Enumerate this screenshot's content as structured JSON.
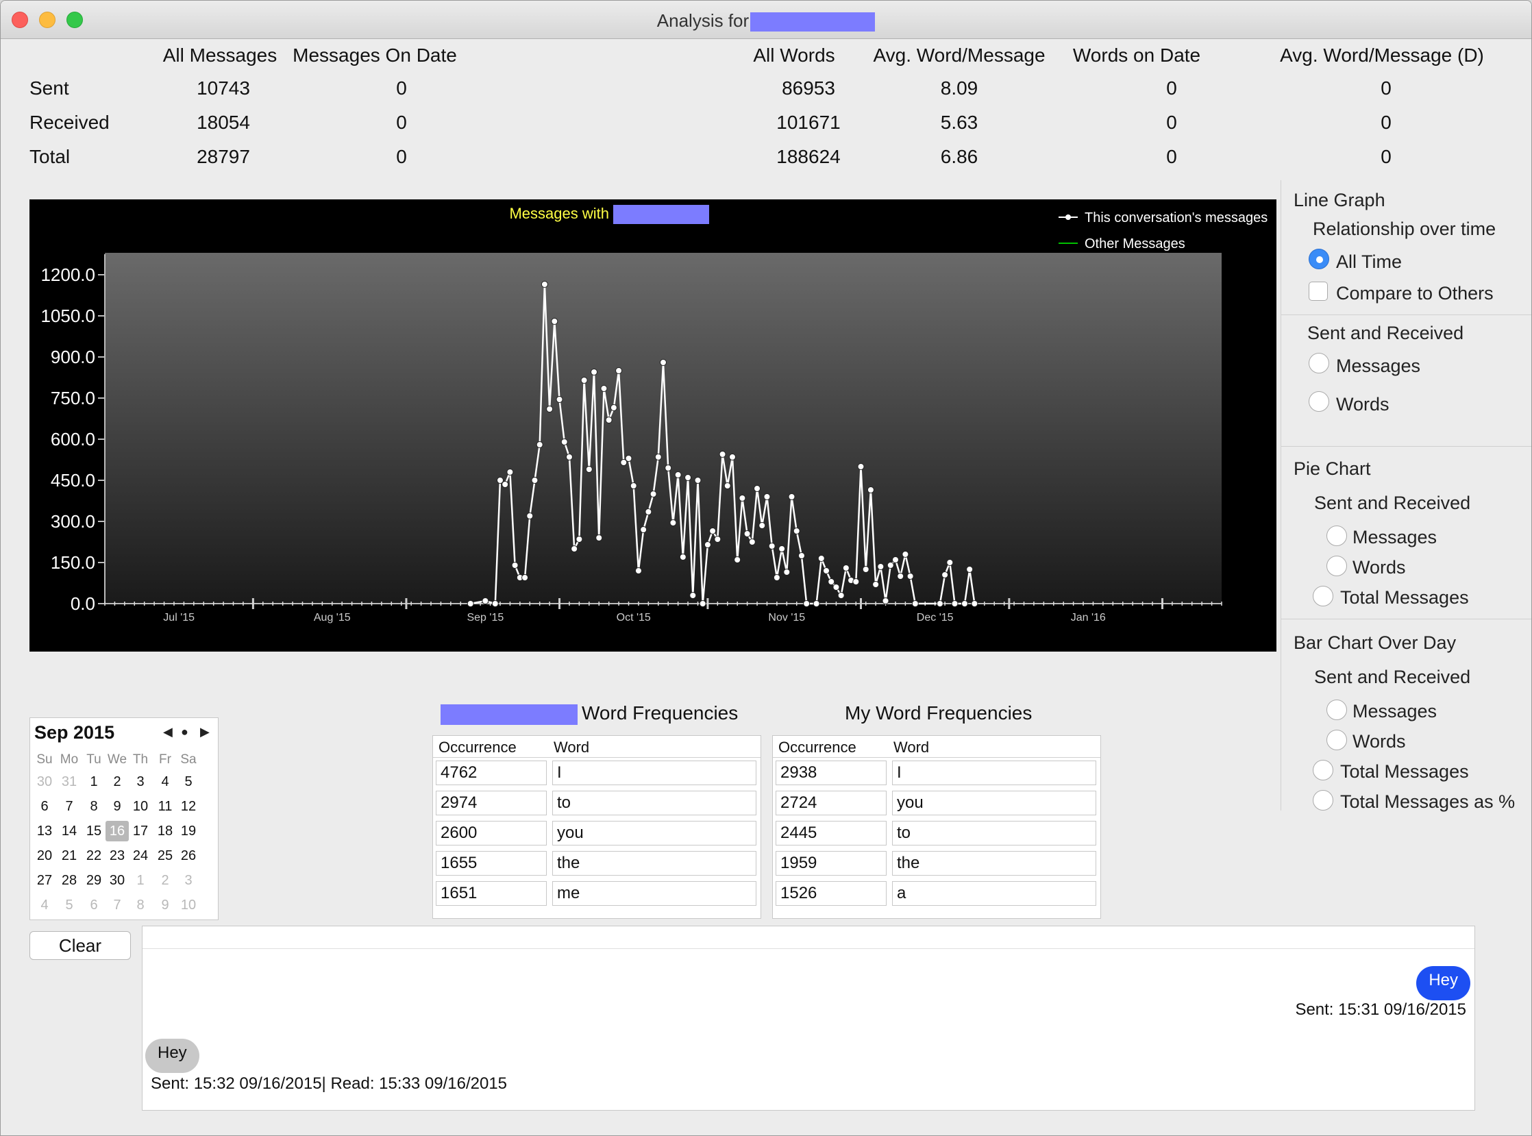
{
  "window": {
    "title": "Analysis for"
  },
  "stats": {
    "headers": [
      "All Messages",
      "Messages On Date",
      "All Words",
      "Avg. Word/Message",
      "Words on Date",
      "Avg. Word/Message (D)"
    ],
    "rows": [
      {
        "label": "Sent",
        "values": [
          "10743",
          "0",
          "86953",
          "8.09",
          "0",
          "0"
        ]
      },
      {
        "label": "Received",
        "values": [
          "18054",
          "0",
          "101671",
          "5.63",
          "0",
          "0"
        ]
      },
      {
        "label": "Total",
        "values": [
          "28797",
          "0",
          "188624",
          "6.86",
          "0",
          "0"
        ]
      }
    ]
  },
  "chart_data": {
    "type": "line",
    "title": "Messages with",
    "xlabel": "",
    "ylabel": "",
    "ylim": [
      0,
      1200
    ],
    "y_ticks": [
      "0.0",
      "150.0",
      "300.0",
      "450.0",
      "600.0",
      "750.0",
      "900.0",
      "1050.0",
      "1200.0"
    ],
    "x_ticks": [
      "Jul '15",
      "Aug '15",
      "Sep '15",
      "Oct '15",
      "Nov '15",
      "Dec '15",
      "Jan '16"
    ],
    "x_range": [
      "2015-06-16",
      "2016-01-28"
    ],
    "legend_position": "top-right",
    "grid": false,
    "series": [
      {
        "name": "This conversation's messages",
        "color": "#ffffff",
        "points": [
          [
            "2015-08-29",
            0
          ],
          [
            "2015-09-01",
            10
          ],
          [
            "2015-09-03",
            0
          ],
          [
            "2015-09-04",
            450
          ],
          [
            "2015-09-05",
            435
          ],
          [
            "2015-09-06",
            480
          ],
          [
            "2015-09-07",
            140
          ],
          [
            "2015-09-08",
            95
          ],
          [
            "2015-09-09",
            95
          ],
          [
            "2015-09-10",
            320
          ],
          [
            "2015-09-11",
            450
          ],
          [
            "2015-09-12",
            580
          ],
          [
            "2015-09-13",
            1165
          ],
          [
            "2015-09-14",
            710
          ],
          [
            "2015-09-15",
            1030
          ],
          [
            "2015-09-16",
            745
          ],
          [
            "2015-09-17",
            590
          ],
          [
            "2015-09-18",
            535
          ],
          [
            "2015-09-19",
            200
          ],
          [
            "2015-09-20",
            235
          ],
          [
            "2015-09-21",
            815
          ],
          [
            "2015-09-22",
            490
          ],
          [
            "2015-09-23",
            845
          ],
          [
            "2015-09-24",
            240
          ],
          [
            "2015-09-25",
            785
          ],
          [
            "2015-09-26",
            670
          ],
          [
            "2015-09-27",
            715
          ],
          [
            "2015-09-28",
            850
          ],
          [
            "2015-09-29",
            515
          ],
          [
            "2015-09-30",
            530
          ],
          [
            "2015-10-01",
            430
          ],
          [
            "2015-10-02",
            120
          ],
          [
            "2015-10-03",
            270
          ],
          [
            "2015-10-04",
            335
          ],
          [
            "2015-10-05",
            400
          ],
          [
            "2015-10-06",
            535
          ],
          [
            "2015-10-07",
            880
          ],
          [
            "2015-10-08",
            495
          ],
          [
            "2015-10-09",
            295
          ],
          [
            "2015-10-10",
            470
          ],
          [
            "2015-10-11",
            170
          ],
          [
            "2015-10-12",
            460
          ],
          [
            "2015-10-13",
            30
          ],
          [
            "2015-10-14",
            450
          ],
          [
            "2015-10-15",
            0
          ],
          [
            "2015-10-16",
            215
          ],
          [
            "2015-10-17",
            265
          ],
          [
            "2015-10-18",
            235
          ],
          [
            "2015-10-19",
            545
          ],
          [
            "2015-10-20",
            430
          ],
          [
            "2015-10-21",
            535
          ],
          [
            "2015-10-22",
            160
          ],
          [
            "2015-10-23",
            385
          ],
          [
            "2015-10-24",
            255
          ],
          [
            "2015-10-25",
            225
          ],
          [
            "2015-10-26",
            420
          ],
          [
            "2015-10-27",
            285
          ],
          [
            "2015-10-28",
            390
          ],
          [
            "2015-10-29",
            210
          ],
          [
            "2015-10-30",
            95
          ],
          [
            "2015-10-31",
            200
          ],
          [
            "2015-11-01",
            115
          ],
          [
            "2015-11-02",
            390
          ],
          [
            "2015-11-03",
            265
          ],
          [
            "2015-11-04",
            175
          ],
          [
            "2015-11-05",
            0
          ],
          [
            "2015-11-07",
            0
          ],
          [
            "2015-11-08",
            165
          ],
          [
            "2015-11-09",
            120
          ],
          [
            "2015-11-10",
            80
          ],
          [
            "2015-11-11",
            60
          ],
          [
            "2015-11-12",
            30
          ],
          [
            "2015-11-13",
            130
          ],
          [
            "2015-11-14",
            85
          ],
          [
            "2015-11-15",
            80
          ],
          [
            "2015-11-16",
            500
          ],
          [
            "2015-11-17",
            125
          ],
          [
            "2015-11-18",
            415
          ],
          [
            "2015-11-19",
            70
          ],
          [
            "2015-11-20",
            135
          ],
          [
            "2015-11-21",
            10
          ],
          [
            "2015-11-22",
            140
          ],
          [
            "2015-11-23",
            160
          ],
          [
            "2015-11-24",
            100
          ],
          [
            "2015-11-25",
            180
          ],
          [
            "2015-11-26",
            100
          ],
          [
            "2015-11-27",
            0
          ],
          [
            "2015-12-02",
            0
          ],
          [
            "2015-12-03",
            105
          ],
          [
            "2015-12-04",
            150
          ],
          [
            "2015-12-05",
            0
          ],
          [
            "2015-12-07",
            0
          ],
          [
            "2015-12-08",
            125
          ],
          [
            "2015-12-09",
            0
          ]
        ]
      },
      {
        "name": "Other Messages",
        "color": "#00c000",
        "points": []
      }
    ]
  },
  "right_panel": {
    "line_graph": {
      "heading": "Line Graph",
      "sub": "Relationship over time",
      "all_time": "All Time",
      "compare": "Compare to Others"
    },
    "sent_received": {
      "heading": "Sent and Received",
      "messages": "Messages",
      "words": "Words"
    },
    "pie_chart": {
      "heading": "Pie Chart",
      "sub": "Sent and Received",
      "messages": "Messages",
      "words": "Words",
      "total": "Total Messages"
    },
    "bar_chart": {
      "heading": "Bar Chart Over Day",
      "sub": "Sent and Received",
      "messages": "Messages",
      "words": "Words",
      "total": "Total Messages",
      "total_pct": "Total Messages as %"
    }
  },
  "calendar": {
    "month": "Sep 2015",
    "dow": [
      "Su",
      "Mo",
      "Tu",
      "We",
      "Th",
      "Fr",
      "Sa"
    ],
    "weeks": [
      [
        "30",
        "31",
        "1",
        "2",
        "3",
        "4",
        "5"
      ],
      [
        "6",
        "7",
        "8",
        "9",
        "10",
        "11",
        "12"
      ],
      [
        "13",
        "14",
        "15",
        "16",
        "17",
        "18",
        "19"
      ],
      [
        "20",
        "21",
        "22",
        "23",
        "24",
        "25",
        "26"
      ],
      [
        "27",
        "28",
        "29",
        "30",
        "1",
        "2",
        "3"
      ],
      [
        "4",
        "5",
        "6",
        "7",
        "8",
        "9",
        "10"
      ]
    ],
    "selected": "16"
  },
  "word_freq": {
    "theirs": {
      "title": "Word Frequencies",
      "columns": [
        "Occurrence",
        "Word"
      ],
      "rows": [
        [
          "4762",
          "I"
        ],
        [
          "2974",
          "to"
        ],
        [
          "2600",
          "you"
        ],
        [
          "1655",
          "the"
        ],
        [
          "1651",
          "me"
        ]
      ]
    },
    "mine": {
      "title": "My Word Frequencies",
      "columns": [
        "Occurrence",
        "Word"
      ],
      "rows": [
        [
          "2938",
          "I"
        ],
        [
          "2724",
          "you"
        ],
        [
          "2445",
          "to"
        ],
        [
          "1959",
          "the"
        ],
        [
          "1526",
          "a"
        ]
      ]
    }
  },
  "clear_label": "Clear",
  "messages": [
    {
      "text": "Hey",
      "meta": "Sent: 15:31 09/16/2015",
      "direction": "sent"
    },
    {
      "text": "Hey",
      "meta": "Sent: 15:32 09/16/2015| Read: 15:33 09/16/2015",
      "direction": "received"
    }
  ]
}
